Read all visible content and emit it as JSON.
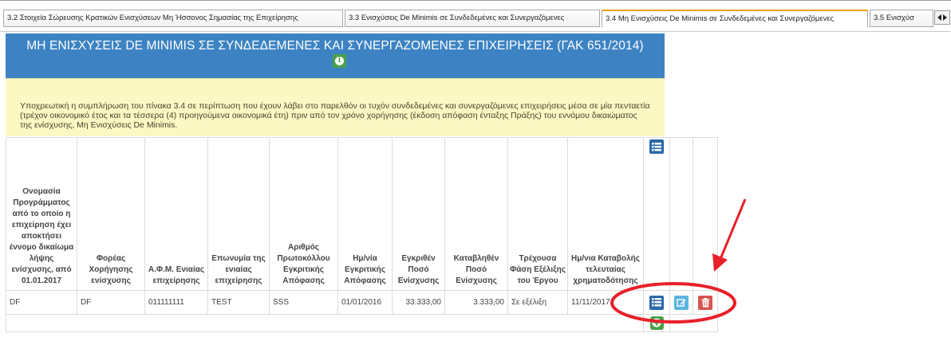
{
  "tabs": [
    {
      "label": "3.2 Στοιχεία Σώρευσης Κρατικών Ενισχύσεων Μη Ήσσονος Σημασίας της Επιχείρησης",
      "active": false
    },
    {
      "label": "3.3 Ενισχύσεις De Minimis σε Συνδεδεμένες και Συνεργαζόμενες",
      "active": false
    },
    {
      "label": "3.4 Μη Ενισχύσεις De Minimis σε Συνδεδεμένες και Συνεργαζόμενες",
      "active": true
    },
    {
      "label": "3.5 Ενισχύσ",
      "active": false
    }
  ],
  "header": {
    "title": "ΜΗ ΕΝΙΣΧΥΣΕΙΣ DE MINIMIS ΣΕ ΣΥΝΔΕΔΕΜΕΝΕΣ ΚΑΙ ΣΥΝΕΡΓΑΖΟΜΕΝΕΣ ΕΠΙΧΕΙΡΗΣΕΙΣ (ΓΑΚ 651/2014)"
  },
  "notice": {
    "text": "Υποχρεωτική η συμπλήρωση του πίνακα 3.4 σε περίπτωση που έχουν λάβει στο παρελθόν οι τυχόν συνδεδεμένες και συνεργαζόμενες επιχειρήσεις μέσα σε μία πενταετία (τρέχον οικονομικό έτος και τα τέσσερα (4) προηγούμενα οικονομικά έτη) πριν από τον χρόνο χορήγησης (έκδοση απόφαση ένταξης Πράξης) του εννόμου δικαιώματος της ενίσχυσης, Μη Ενισχύσεις De Minimis."
  },
  "table": {
    "columns": [
      "Ονομασία Προγράμματος από το οποίο η επιχείρηση έχει αποκτήσει έννομο δικαίωμα λήψης ενίσχυσης, από 01.01.2017",
      "Φορέας Χορήγησης ενίσχυσης",
      "Α.Φ.Μ. Ενιαίας επιχείρησης",
      "Επωνυμία της ενιαίας επιχείρησης",
      "Αριθμός Πρωτοκόλλου Εγκριτικής Απόφασης",
      "Ημ/νία Εγκριτικής Απόφασης",
      "Εγκριθέν Ποσό Ενίσχυσης",
      "Καταβληθέν Ποσό Ενίσχυσης",
      "Τρέχουσα Φάση Εξέλιξης του Έργου",
      "Ημ/νια Καταβολής τελευταίας χρηματοδότησης"
    ],
    "rows": [
      [
        "DF",
        "DF",
        "011111111",
        "TEST",
        "SSS",
        "01/01/2016",
        "33.333,00",
        "3.333,00",
        "Σε εξέλιξη",
        "11/11/2017"
      ]
    ]
  },
  "icons": {
    "info": "info-icon",
    "list": "list-icon",
    "edit": "edit-icon",
    "delete": "trash-icon",
    "add": "add-icon"
  },
  "colors": {
    "header_bg": "#3d83c3",
    "notice_bg": "#fcf8c4",
    "annotation": "#e8202a"
  }
}
